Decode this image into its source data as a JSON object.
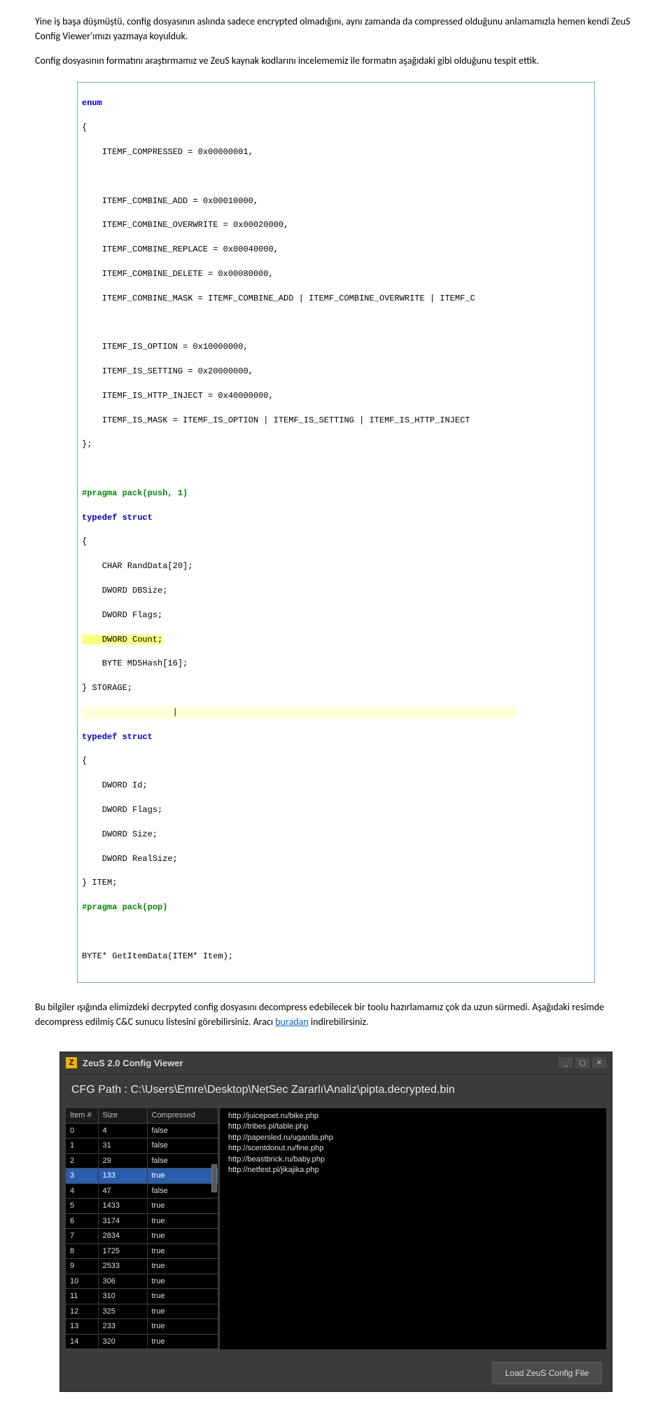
{
  "paragraphs": {
    "p1": "Yine iş başa düşmüştü, config dosyasının aslında sadece encrypted olmadığını, aynı zamanda da compressed olduğunu anlamamızla hemen kendi ZeuS Config Viewer'ımızı yazmaya koyulduk.",
    "p2": "Config dosyasının formatını araştırmamız ve ZeuS kaynak kodlarını incelememiz ile formatın aşağıdaki gibi olduğunu tespit ettik.",
    "p3_a": "Bu bilgiler ışığında elimizdeki decrpyted config dosyasını decompress edebilecek bir toolu hazırlamamız çok da uzun sürmedi. Aşağıdaki resimde decompress edilmiş C&C sunucu listesini görebilirsiniz. Aracı ",
    "p3_link": "buradan",
    "p3_b": " indirebilirsiniz."
  },
  "code": {
    "enum_kw": "enum",
    "l_brace": "{",
    "r_brace_semi": "};",
    "r_brace_name1": "} STORAGE;",
    "r_brace_name2": "} ITEM;",
    "lines": {
      "c1": "    ITEMF_COMPRESSED = 0x00000001,",
      "c2": "    ITEMF_COMBINE_ADD = 0x00010000,",
      "c3": "    ITEMF_COMBINE_OVERWRITE = 0x00020000,",
      "c4": "    ITEMF_COMBINE_REPLACE = 0x00040000,",
      "c5": "    ITEMF_COMBINE_DELETE = 0x00080000,",
      "c6": "    ITEMF_COMBINE_MASK = ITEMF_COMBINE_ADD | ITEMF_COMBINE_OVERWRITE | ITEMF_C",
      "c7": "    ITEMF_IS_OPTION = 0x10000000,",
      "c8": "    ITEMF_IS_SETTING = 0x20000000,",
      "c9": "    ITEMF_IS_HTTP_INJECT = 0x40000000,",
      "c10": "    ITEMF_IS_MASK = ITEMF_IS_OPTION | ITEMF_IS_SETTING | ITEMF_IS_HTTP_INJECT",
      "s1": "    CHAR RandData[20];",
      "s2": "    DWORD DBSize;",
      "s3": "    DWORD Flags;",
      "s4": "    DWORD Count;",
      "s5": "    BYTE MD5Hash[16];",
      "i1": "    DWORD Id;",
      "i2": "    DWORD Flags;",
      "i3": "    DWORD Size;",
      "i4": "    DWORD RealSize;",
      "fn": "BYTE* GetItemData(ITEM* Item);"
    },
    "pragma_push": "#pragma pack(push, 1)",
    "pragma_pop": "#pragma pack(pop)",
    "typedef": "typedef struct",
    "cursor": "|"
  },
  "app": {
    "title": "ZeuS 2.0 Config Viewer",
    "zicon": "Z",
    "min": "_",
    "max": "▢",
    "close": "✕",
    "cfg_label": "CFG Path : C:\\Users\\Emre\\Desktop\\NetSec Zararlı\\Analiz\\pipta.decrypted.bin",
    "headers": {
      "item": "Item #",
      "size": "Size",
      "comp": "Compressed"
    },
    "rows": [
      {
        "item": "0",
        "size": "4",
        "comp": "false",
        "sel": false
      },
      {
        "item": "1",
        "size": "31",
        "comp": "false",
        "sel": false
      },
      {
        "item": "2",
        "size": "29",
        "comp": "false",
        "sel": false
      },
      {
        "item": "3",
        "size": "133",
        "comp": "true",
        "sel": true
      },
      {
        "item": "4",
        "size": "47",
        "comp": "false",
        "sel": false
      },
      {
        "item": "5",
        "size": "1433",
        "comp": "true",
        "sel": false
      },
      {
        "item": "6",
        "size": "3174",
        "comp": "true",
        "sel": false
      },
      {
        "item": "7",
        "size": "2834",
        "comp": "true",
        "sel": false
      },
      {
        "item": "8",
        "size": "1725",
        "comp": "true",
        "sel": false
      },
      {
        "item": "9",
        "size": "2533",
        "comp": "true",
        "sel": false
      },
      {
        "item": "10",
        "size": "306",
        "comp": "true",
        "sel": false
      },
      {
        "item": "11",
        "size": "310",
        "comp": "true",
        "sel": false
      },
      {
        "item": "12",
        "size": "325",
        "comp": "true",
        "sel": false
      },
      {
        "item": "13",
        "size": "233",
        "comp": "true",
        "sel": false
      },
      {
        "item": "14",
        "size": "320",
        "comp": "true",
        "sel": false
      }
    ],
    "urls": [
      "http://juicepoet.ru/bike.php",
      "http://tribes.pl/table.php",
      "http://papersled.ru/uganda.php",
      "http://scentdonut.ru/fine.php",
      "http://beastbrick.ru/baby.php",
      "http://netfest.pl/jikajika.php"
    ],
    "load_btn": "Load ZeuS Config File"
  }
}
